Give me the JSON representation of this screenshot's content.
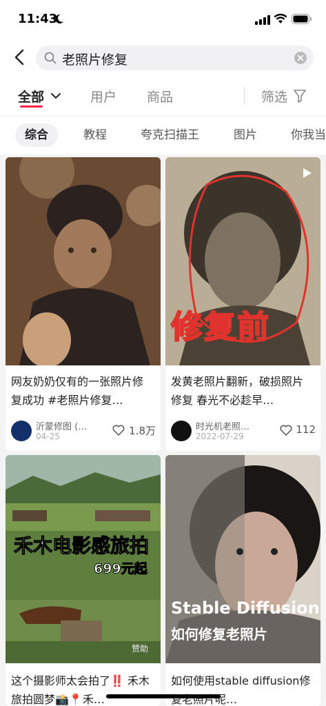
{
  "status": {
    "time": "11:43"
  },
  "search": {
    "query": "老照片修复"
  },
  "tabs": {
    "all": "全部",
    "users": "用户",
    "goods": "商品",
    "filter": "筛选"
  },
  "chips": [
    "综合",
    "教程",
    "夸克扫描王",
    "图片",
    "你我当"
  ],
  "cards": [
    {
      "title": "网友奶奶仅有的一张照片修复成功 #老照片修复…",
      "author": "沂蒙修图 (…",
      "date": "04-25",
      "likes": "1.8万"
    },
    {
      "title": "发黄老照片翻新，破损照片修复 春光不必趁早…",
      "author": "时光机老照…",
      "date": "2022-07-29",
      "likes": "112",
      "overlay": "修复前"
    },
    {
      "title": "这个摄影师太会拍了‼️ 禾木旅拍圆梦📸📍禾…",
      "overlay": "禾木电影感旅拍",
      "price": "699元起",
      "sponsor": "赞助"
    },
    {
      "title": "如何使用stable diffusion修复老照片呢…",
      "overlay1": "Stable Diffusion",
      "overlay2": "如何修复老照片"
    }
  ],
  "colors": {
    "accent": "#ff2442"
  }
}
